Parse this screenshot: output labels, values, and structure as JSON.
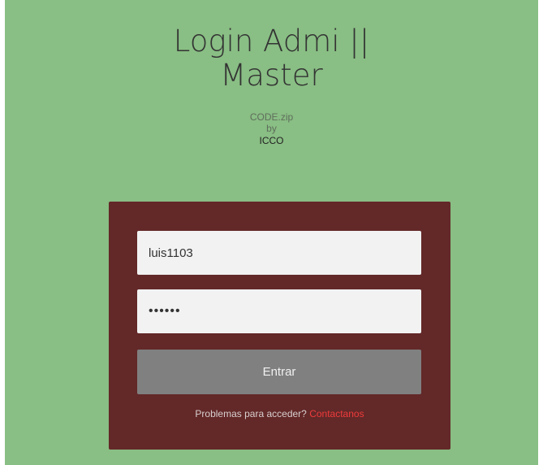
{
  "header": {
    "title_line1": "Login Admi ||",
    "title_line2": "Master",
    "credit_line1": "CODE.zip",
    "credit_line2": "by",
    "credit_line3": "ICCO"
  },
  "form": {
    "username_value": "luis1103",
    "password_value": "••••••",
    "submit_label": "Entrar",
    "help_text": "Problemas para acceder?",
    "help_link": "Contactanos"
  },
  "colors": {
    "page_background": "#89be84",
    "form_background": "#632828",
    "button_background": "#808080",
    "link_color": "#ef3b3b"
  }
}
